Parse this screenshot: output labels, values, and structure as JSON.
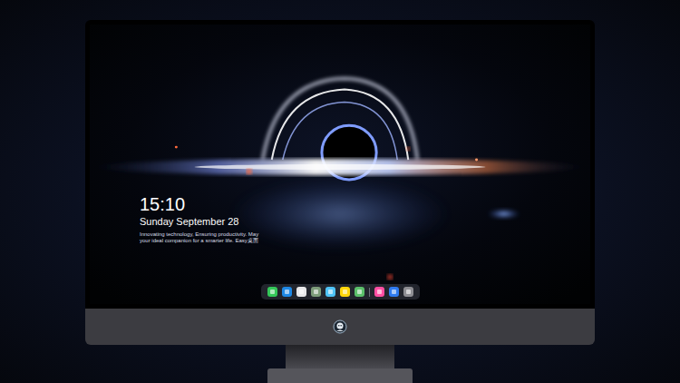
{
  "lock_screen": {
    "time": "15:10",
    "date": "Sunday September 28",
    "tagline": [
      "Innovating technology, Ensuring productivity. May",
      "your ideal companion for a smarter life. Easy桌面"
    ]
  },
  "dock": {
    "items": [
      {
        "kind": "app",
        "color": "#34c759"
      },
      {
        "kind": "app",
        "color": "#1e88e5"
      },
      {
        "kind": "app",
        "color": "#e8e8ea"
      },
      {
        "kind": "app",
        "color": "#7d9c7a"
      },
      {
        "kind": "app",
        "color": "#4fc3f7"
      },
      {
        "kind": "app",
        "color": "#ffd60a"
      },
      {
        "kind": "app",
        "color": "#5bbf6a"
      },
      {
        "kind": "separator",
        "color": "#6b6f7a"
      },
      {
        "kind": "app",
        "color": "#ff4fa3"
      },
      {
        "kind": "app",
        "color": "#2f7bf0"
      },
      {
        "kind": "app",
        "color": "#8e8e93"
      }
    ]
  }
}
